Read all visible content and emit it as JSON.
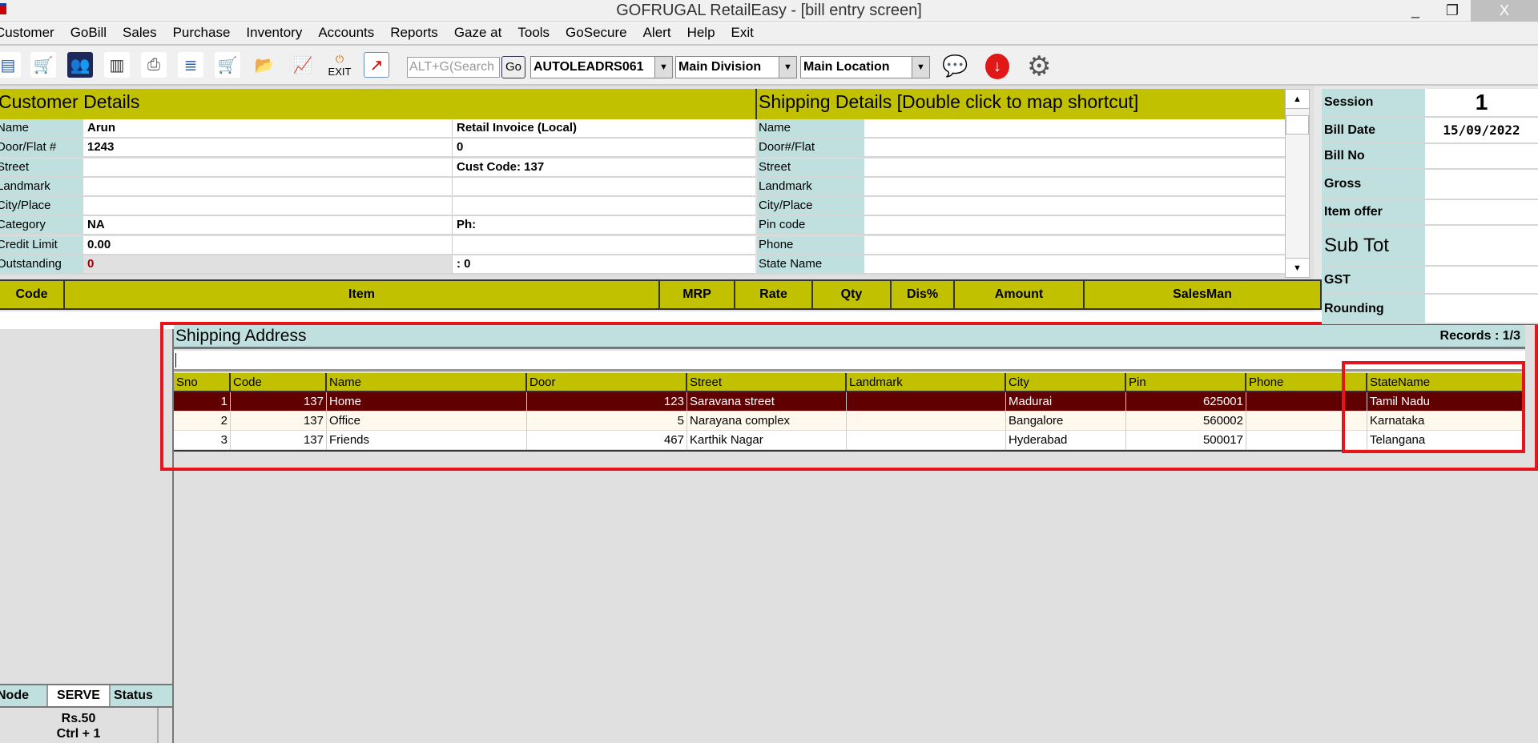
{
  "window": {
    "title": "GOFRUGAL RetailEasy - [bill entry screen]",
    "minimize": "_",
    "restore": "❐",
    "close": "X"
  },
  "menu": [
    "Customer",
    "GoBill",
    "Sales",
    "Purchase",
    "Inventory",
    "Accounts",
    "Reports",
    "Gaze at",
    "Tools",
    "GoSecure",
    "Alert",
    "Help",
    "Exit"
  ],
  "toolbar": {
    "icons": [
      "invoice-icon",
      "cart-bill-icon",
      "customers-icon",
      "barcode-icon",
      "print-icon",
      "list-icon",
      "purchase-cart-icon",
      "folder-icon",
      "chart-icon",
      "exit-icon",
      "report-icon"
    ],
    "exit_label": "EXIT",
    "search_placeholder": "ALT+G(Search",
    "go_label": "Go",
    "user": "AUTOLEADRS061",
    "division": "Main Division",
    "location": "Main Location"
  },
  "customer": {
    "title": "Customer Details",
    "labels": [
      "Name",
      "Door/Flat #",
      "Street",
      "Landmark",
      "City/Place",
      "Category",
      "Credit Limit",
      "Outstanding"
    ],
    "values": [
      "Arun",
      "1243",
      "",
      "",
      "",
      "NA",
      "0.00",
      "0"
    ],
    "extra": [
      "Retail Invoice (Local)",
      "0",
      "Cust Code: 137",
      "",
      "",
      "Ph:",
      "",
      ":  0"
    ]
  },
  "shipping": {
    "title": "Shipping Details   [Double click to map shortcut]",
    "labels": [
      "Name",
      "Door#/Flat",
      "Street",
      "Landmark",
      "City/Place",
      "Pin code",
      "Phone",
      "State Name"
    ]
  },
  "summary": {
    "labels": [
      "Session",
      "Bill Date",
      "Bill No",
      "Gross",
      "Item offer",
      "Sub Tot",
      "GST",
      "Rounding"
    ],
    "values": [
      "1",
      "15/09/2022",
      "",
      "",
      "",
      "",
      "",
      ""
    ]
  },
  "grid": {
    "columns": [
      "Code",
      "Item",
      "MRP",
      "Rate",
      "Qty",
      "Dis%",
      "Amount",
      "SalesMan"
    ]
  },
  "popup": {
    "title": "Shipping Address",
    "records": "Records : 1/3",
    "search_value": "",
    "columns": [
      "Sno",
      "Code",
      "Name",
      "Door",
      "Street",
      "Landmark",
      "City",
      "Pin",
      "Phone",
      "StateName"
    ],
    "rows": [
      [
        "1",
        "137",
        "Home",
        "123",
        "Saravana street",
        "",
        "Madurai",
        "625001",
        "",
        "Tamil Nadu"
      ],
      [
        "2",
        "137",
        "Office",
        "5",
        "Narayana complex",
        "",
        "Bangalore",
        "560002",
        "",
        "Karnataka"
      ],
      [
        "3",
        "137",
        "Friends",
        "467",
        "Karthik Nagar",
        "",
        "Hyderabad",
        "500017",
        "",
        "Telangana"
      ]
    ]
  },
  "bottom": {
    "node": "Node",
    "serve": "SERVE",
    "status": "Status",
    "price": "Rs.50",
    "shortcut": "Ctrl + 1"
  },
  "colors": {
    "header": "#c1c100",
    "label": "#c0e0e0",
    "selected": "#600000",
    "highlight": "#e8141c"
  }
}
